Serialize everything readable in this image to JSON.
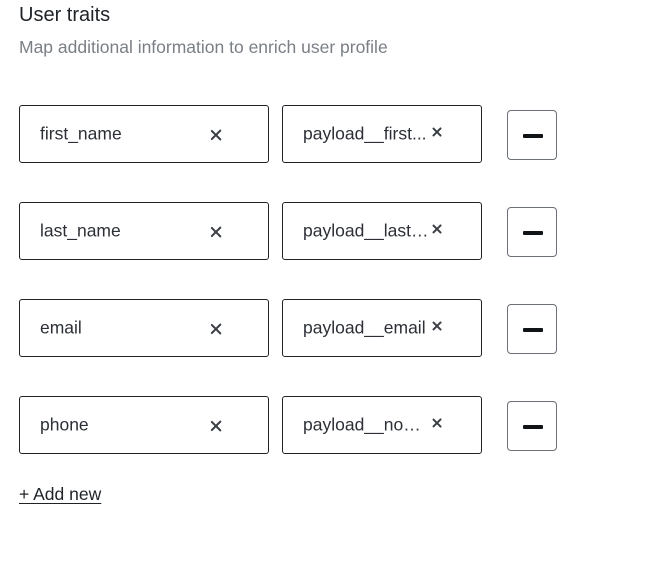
{
  "section": {
    "title": "User traits",
    "subtitle": "Map additional information to enrich user profile"
  },
  "traits": [
    {
      "key": "first_name",
      "value": "payload__first_name",
      "value_display": "payload__first..."
    },
    {
      "key": "last_name",
      "value": "payload__last_name",
      "value_display": "payload__last_..."
    },
    {
      "key": "email",
      "value": "payload__email",
      "value_display": "payload__email"
    },
    {
      "key": "phone",
      "value": "payload__no_s",
      "value_display": "payload__no_s..."
    }
  ],
  "icons": {
    "clear": "close-icon",
    "remove": "minus-icon"
  },
  "actions": {
    "add_new_label": "+ Add new"
  }
}
